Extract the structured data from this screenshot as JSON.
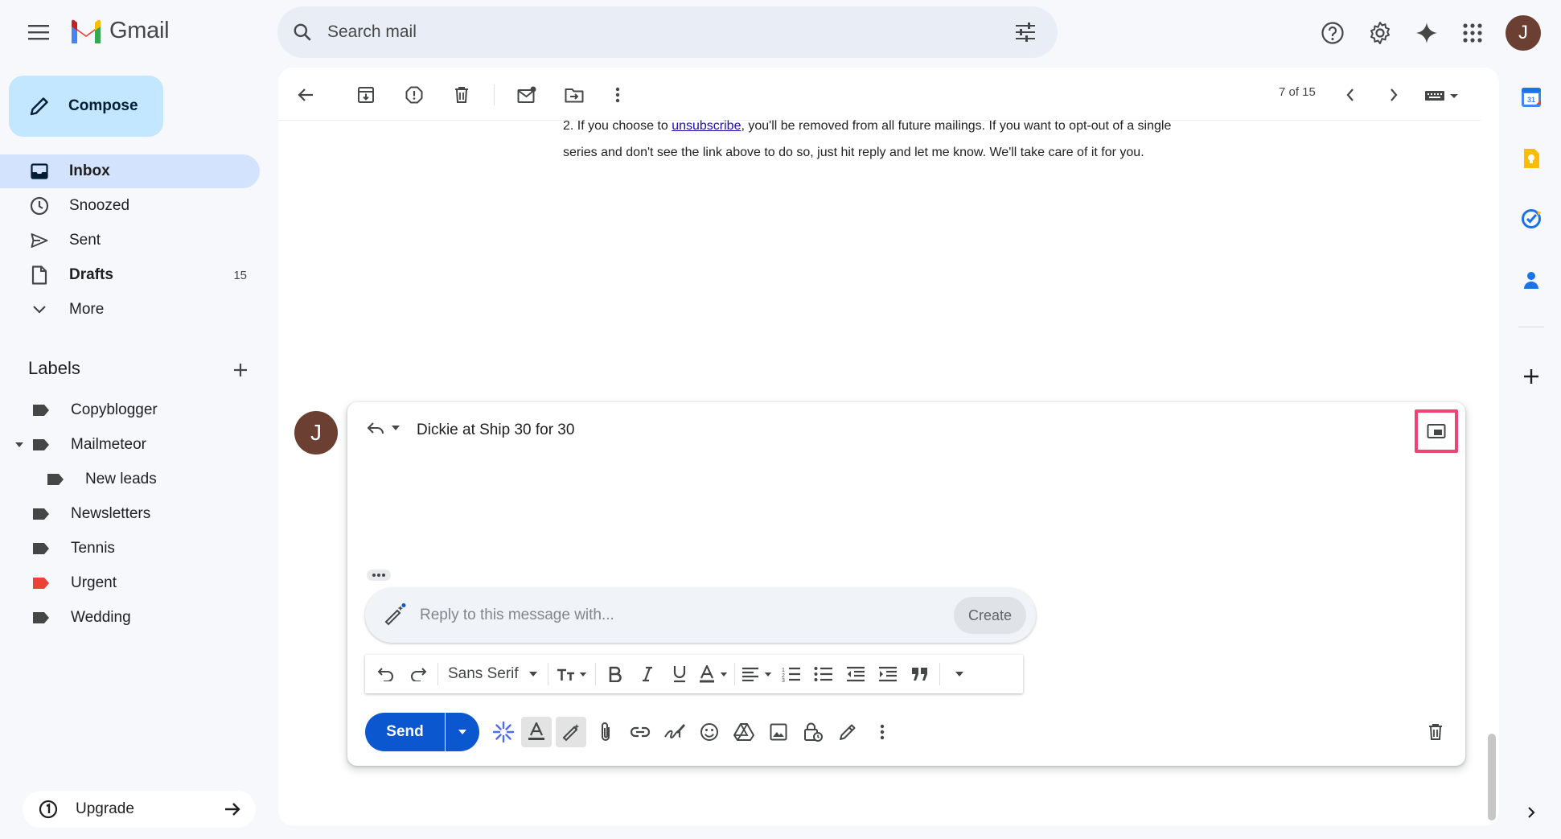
{
  "app": {
    "logo_text": "Gmail",
    "avatar_initial": "J"
  },
  "search": {
    "placeholder": "Search mail"
  },
  "sidebar": {
    "compose_label": "Compose",
    "items": [
      {
        "label": "Inbox",
        "count": "",
        "icon": "inbox-icon",
        "active": true
      },
      {
        "label": "Snoozed",
        "count": "",
        "icon": "clock-icon"
      },
      {
        "label": "Sent",
        "count": "",
        "icon": "send-icon"
      },
      {
        "label": "Drafts",
        "count": "15",
        "icon": "draft-icon"
      },
      {
        "label": "More",
        "count": "",
        "icon": "chevron-down-icon"
      }
    ],
    "labels_title": "Labels",
    "labels": [
      {
        "name": "Copyblogger",
        "color": "#444746"
      },
      {
        "name": "Mailmeteor",
        "color": "#444746",
        "expanded": true
      },
      {
        "name": "New leads",
        "color": "#444746",
        "nested": true
      },
      {
        "name": "Newsletters",
        "color": "#444746"
      },
      {
        "name": "Tennis",
        "color": "#444746"
      },
      {
        "name": "Urgent",
        "color": "#ea4335"
      },
      {
        "name": "Wedding",
        "color": "#444746"
      }
    ],
    "upgrade_label": "Upgrade"
  },
  "toolbar": {
    "pager": "7 of 15"
  },
  "message": {
    "line1_prefix": "2. If you choose to ",
    "link_text": "unsubscribe",
    "line1_suffix": ", you'll be removed from all future mailings. If you want to opt-out of a single",
    "line2": "series and don't see the link above to do so, just hit reply and let me know. We'll take care of it for you."
  },
  "reply": {
    "avatar_initial": "J",
    "recipient": "Dickie at Ship 30 for 30",
    "ai_placeholder": "Reply to this message with...",
    "ai_create_label": "Create",
    "font_name": "Sans Serif",
    "send_label": "Send"
  },
  "colors": {
    "accent": "#0b57d0",
    "compose_bg": "#c2e7ff",
    "active_nav": "#d3e3fd",
    "highlight_box": "#ef4372"
  }
}
